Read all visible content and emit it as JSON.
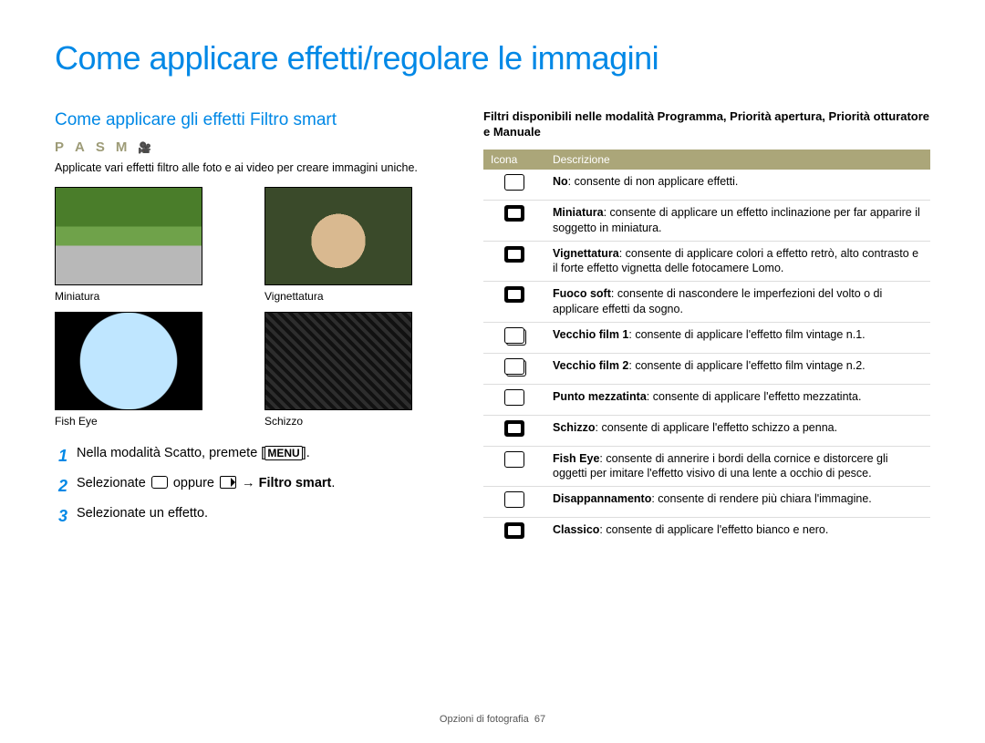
{
  "page_title": "Come applicare effetti/regolare le immagini",
  "section_title": "Come applicare gli effetti Filtro smart",
  "mode_letters": [
    "P",
    "A",
    "S",
    "M"
  ],
  "intro": "Applicate vari effetti filtro alle foto e ai video per creare immagini uniche.",
  "thumbs": {
    "miniatura": "Miniatura",
    "vignettatura": "Vignettatura",
    "fisheye": "Fish Eye",
    "schizzo": "Schizzo"
  },
  "steps": {
    "s1_a": "Nella modalità Scatto, premete [",
    "s1_menu": "MENU",
    "s1_b": "].",
    "s2_a": "Selezionate ",
    "s2_b": " oppure ",
    "s2_c": " → ",
    "s2_d": "Filtro smart",
    "s2_e": ".",
    "s3": "Selezionate un effetto."
  },
  "step_nums": {
    "n1": "1",
    "n2": "2",
    "n3": "3"
  },
  "right_heading": "Filtri disponibili nelle modalità Programma, Priorità apertura, Priorità otturatore e Manuale",
  "table_headers": {
    "icon": "Icona",
    "desc": "Descrizione"
  },
  "rows": [
    {
      "title": "No",
      "text": ": consente di non applicare effetti."
    },
    {
      "title": "Miniatura",
      "text": ": consente di applicare un effetto inclinazione per far apparire il soggetto in miniatura."
    },
    {
      "title": "Vignettatura",
      "text": ": consente di applicare colori a effetto retrò, alto contrasto e il forte effetto vignetta delle fotocamere Lomo."
    },
    {
      "title": "Fuoco soft",
      "text": ": consente di nascondere le imperfezioni del volto o di applicare effetti da sogno."
    },
    {
      "title": "Vecchio film 1",
      "text": ": consente di applicare l'effetto film vintage n.1."
    },
    {
      "title": "Vecchio film 2",
      "text": ": consente di applicare l'effetto film vintage n.2."
    },
    {
      "title": "Punto mezzatinta",
      "text": ": consente di applicare l'effetto mezzatinta."
    },
    {
      "title": "Schizzo",
      "text": ": consente di applicare l'effetto schizzo a penna."
    },
    {
      "title": "Fish Eye",
      "text": ": consente di annerire i bordi della cornice e distorcere gli oggetti per imitare l'effetto visivo di una lente a occhio di pesce."
    },
    {
      "title": "Disappannamento",
      "text": ": consente di rendere più chiara l'immagine."
    },
    {
      "title": "Classico",
      "text": ": consente di applicare l'effetto bianco e nero."
    }
  ],
  "footer_section": "Opzioni di fotografia",
  "footer_page": "67"
}
